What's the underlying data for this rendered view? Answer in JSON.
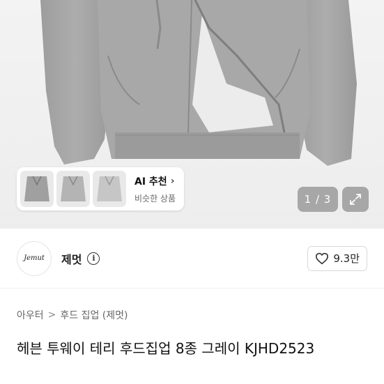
{
  "ai_recommend": {
    "title": "AI 추천",
    "chevron": "›",
    "subtitle": "비슷한 상품"
  },
  "gallery": {
    "pager": "1 / 3",
    "expand_icon": "expand-icon"
  },
  "shop": {
    "logo_text": "Jemut",
    "name": "제멋",
    "info_icon": "i",
    "likes": "9.3만"
  },
  "breadcrumb": {
    "items": [
      "아우터",
      "후드 집업 (제멋)"
    ],
    "separator": ">"
  },
  "product": {
    "title": "헤븐 투웨이 테리 후드집업 8종 그레이 KJHD2523"
  },
  "colors": {
    "hoodie": "#a5a5a5",
    "like_icon": "#333333"
  }
}
